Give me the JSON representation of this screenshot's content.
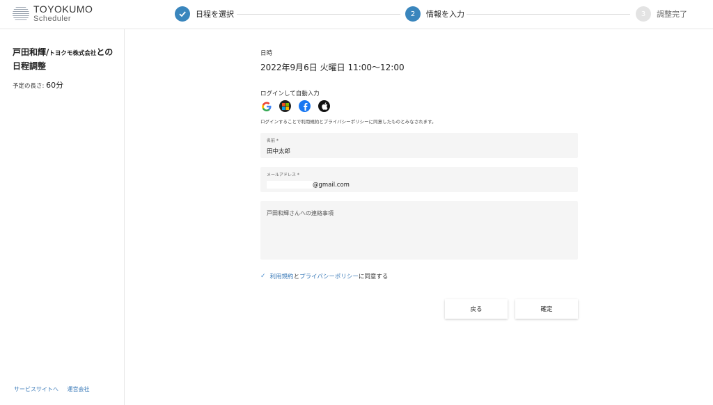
{
  "brand": {
    "name": "TOYOKUMO",
    "sub": "Scheduler"
  },
  "steps": [
    {
      "label": "日程を選択",
      "state": "done"
    },
    {
      "label": "情報を入力",
      "state": "active",
      "number": "2"
    },
    {
      "label": "調整完了",
      "state": "pending",
      "number": "3"
    }
  ],
  "sidebar": {
    "title_name": "戸田和輝/",
    "title_company": "トヨクモ株式会社",
    "title_suffix": "との",
    "title_line2": "日程調整",
    "duration_label": "予定の長さ: ",
    "duration_value": "60分",
    "footer_links": [
      "サービスサイトへ",
      "運営会社"
    ]
  },
  "form": {
    "datetime_label": "日時",
    "datetime_value": "2022年9月6日 火曜日 11:00〜12:00",
    "login_label": "ログインして自動入力",
    "sso_icons": [
      "google-icon",
      "microsoft-icon",
      "facebook-icon",
      "apple-icon"
    ],
    "login_note": "ログインすることで利用規約とプライバシーポリシーに同意したものとみなされます。",
    "name_label": "名前 *",
    "name_value": "田中太郎",
    "email_label": "メールアドレス *",
    "email_value": "@gmail.com",
    "message_placeholder": "戸田和輝さんへの連絡事項",
    "agree_terms": "利用規約",
    "agree_and": "と",
    "agree_privacy": "プライバシーポリシー",
    "agree_suffix": "に同意する",
    "back_label": "戻る",
    "confirm_label": "確定"
  },
  "colors": {
    "accent": "#3a86bd",
    "link": "#3a7ab8",
    "field_bg": "#f5f5f5"
  }
}
